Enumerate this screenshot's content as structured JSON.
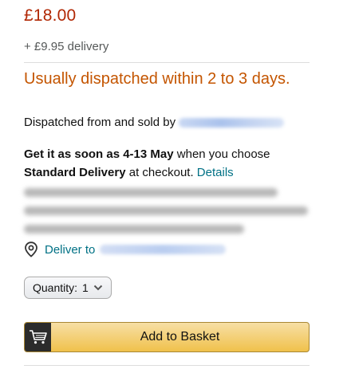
{
  "price": "£18.00",
  "delivery_fee": "+ £9.95 delivery",
  "availability": "Usually dispatched within 2 to 3 days.",
  "sold_by": {
    "prefix": "Dispatched from and sold by"
  },
  "eta": {
    "part1": "Get it as soon as",
    "dates": "4-13 May",
    "part2": "when you choose",
    "method": "Standard Delivery",
    "part3": "at checkout.",
    "details_link": "Details"
  },
  "deliver_to": {
    "label": "Deliver to",
    "icon": "location-pin-icon"
  },
  "quantity": {
    "label": "Quantity:",
    "value": "1"
  },
  "basket_button": {
    "label": "Add to Basket",
    "icon": "cart-icon"
  },
  "colors": {
    "price": "#B12704",
    "availability": "#C45500",
    "link": "#007185",
    "button": "#F0C14B"
  }
}
